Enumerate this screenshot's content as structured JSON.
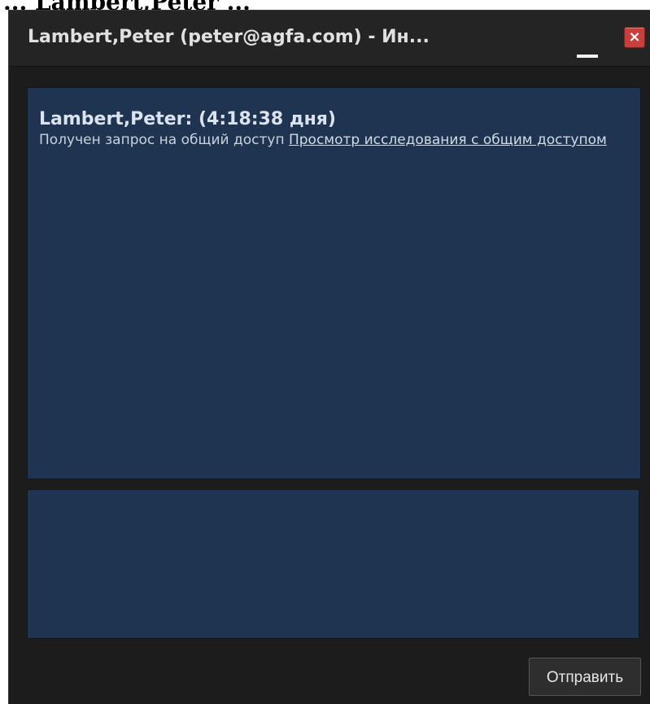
{
  "page_fragment": "... Lambert,Peter ...",
  "window": {
    "title": "Lambert,Peter (peter@agfa.com) - Ин...",
    "close_glyph": "×",
    "icons": [
      "minimize-icon",
      "close-icon"
    ]
  },
  "messages": [
    {
      "header": "Lambert,Peter: (4:18:38 дня)",
      "text": "Получен запрос на общий доступ ",
      "link": "Просмотр исследования с общим доступом"
    }
  ],
  "input": {
    "value": ""
  },
  "send_button": {
    "label": "Отправить"
  },
  "colors": {
    "window_bg": "#1c1c1c",
    "panel_bg": "#1f3450",
    "close_red": "#c8403c"
  }
}
